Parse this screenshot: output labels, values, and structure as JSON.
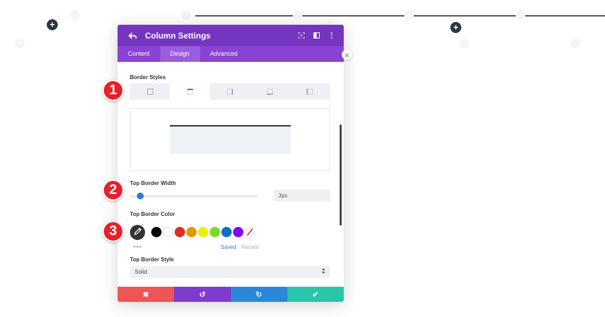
{
  "modal": {
    "title": "Column Settings",
    "tabs": [
      {
        "label": "Content"
      },
      {
        "label": "Design",
        "active": true
      },
      {
        "label": "Advanced"
      }
    ]
  },
  "border_styles": {
    "label": "Border Styles",
    "options": [
      "all-sides",
      "top",
      "right",
      "bottom",
      "left"
    ],
    "active_option": "top"
  },
  "top_border_width": {
    "label": "Top Border Width",
    "value": "3px",
    "slider_fraction": 0.05
  },
  "top_border_color": {
    "label": "Top Border Color",
    "swatches": [
      "#000000",
      "#ffffff",
      "#e02b20",
      "#e09900",
      "#edf000",
      "#7cda24",
      "#0c71c3",
      "#8300e9"
    ],
    "saved_label": "Saved",
    "recent_label": "Recent",
    "more": "•••"
  },
  "top_border_style": {
    "label": "Top Border Style",
    "value": "Solid"
  },
  "footer": {
    "cancel_icon": "✖",
    "undo_icon": "↺",
    "redo_icon": "↻",
    "save_icon": "✔"
  },
  "markers": {
    "one": "1",
    "two": "2",
    "three": "3"
  },
  "colors": {
    "header": "#7436bf",
    "tabs": "#8a43d3",
    "cancel": "#ef5555",
    "undo": "#7e3bd0",
    "redo": "#2b87da",
    "save": "#29c4a9",
    "marker": "#e8202a"
  },
  "add_icon": "+"
}
